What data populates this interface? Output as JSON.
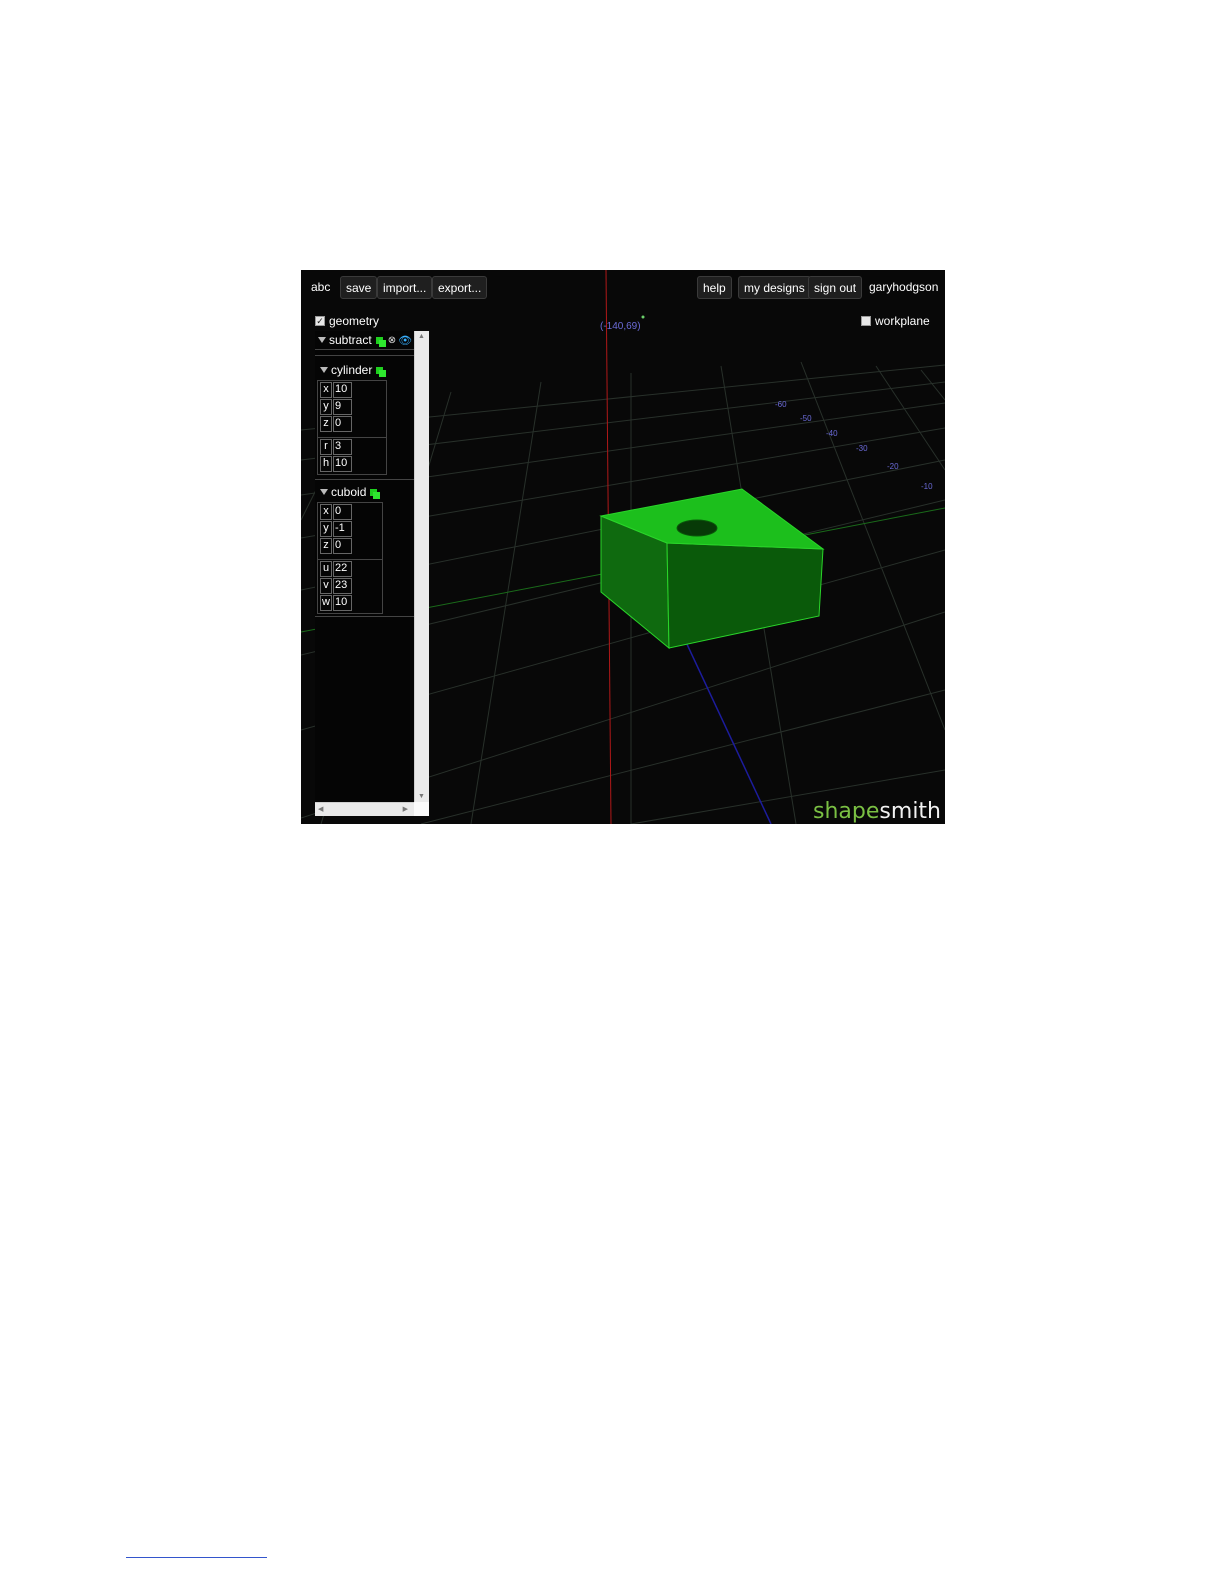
{
  "toolbar": {
    "design_name": "abc",
    "save_label": "save",
    "import_label": "import...",
    "export_label": "export...",
    "help_label": "help",
    "my_designs_label": "my designs",
    "sign_out_label": "sign out",
    "username": "garyhodgson"
  },
  "toggles": {
    "geometry_label": "geometry",
    "geometry_checked": true,
    "workplane_label": "workplane",
    "workplane_checked": false
  },
  "cursor_coords": "(-140,69)",
  "axis_ticks": [
    "-60",
    "-50",
    "-40",
    "-30",
    "-20",
    "-10"
  ],
  "tree": {
    "root_label": "subtract",
    "cylinder": {
      "label": "cylinder",
      "x": "10",
      "y": "9",
      "z": "0",
      "r": "3",
      "h": "10"
    },
    "cuboid": {
      "label": "cuboid",
      "x": "0",
      "y": "-1",
      "z": "0",
      "u": "22",
      "v": "23",
      "w": "10"
    }
  },
  "logo": {
    "part1": "shape",
    "part2": "smith"
  },
  "colors": {
    "background": "#080808",
    "object_top": "#1ec21e",
    "object_side": "#0f7a0f",
    "grid": "#2a332a",
    "axis_x": "#1a6b1a",
    "axis_y": "#b01818",
    "axis_z": "#1c1c9c",
    "tick_text": "#6b6bd8"
  }
}
